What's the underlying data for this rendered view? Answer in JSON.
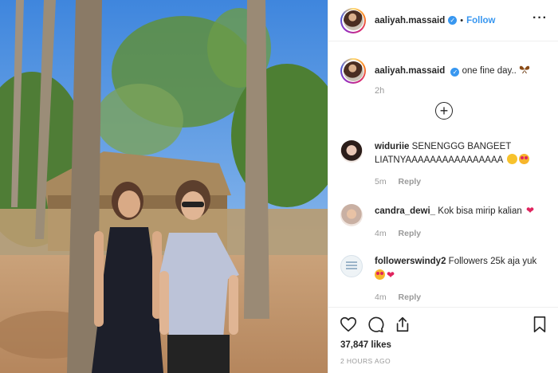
{
  "post": {
    "username": "aaliyah.massaid",
    "verified_mark": "✓",
    "separator": "•",
    "follow_label": "Follow",
    "more_icon": "more-options-icon",
    "more_glyph": "···",
    "caption_text": "one fine day..",
    "caption_emoji": "butterfly",
    "caption_time": "2h",
    "load_more_glyph": "+",
    "likes": "37,847 likes",
    "posted_ago": "2 HOURS AGO"
  },
  "comments": [
    {
      "username": "widuriie",
      "text": "SENENGGG BANGEET LIATNYAAAAAAAAAAAAAAAA",
      "emojis": [
        "smile",
        "heart-eyes"
      ],
      "time": "5m",
      "reply_label": "Reply"
    },
    {
      "username": "candra_dewi_",
      "text": "Kok bisa mirip kalian",
      "emojis": [
        "red-heart"
      ],
      "time": "4m",
      "reply_label": "Reply"
    },
    {
      "username": "followerswindy2",
      "text": "Followers 25k aja yuk",
      "emojis": [
        "heart-eyes",
        "red-heart"
      ],
      "time": "4m",
      "reply_label": "Reply"
    }
  ],
  "colors": {
    "link": "#3897f0",
    "muted": "#999999",
    "text": "#262626",
    "heart": "#e0245e"
  },
  "icons": [
    "heart-icon",
    "comment-icon",
    "share-icon",
    "bookmark-icon"
  ]
}
